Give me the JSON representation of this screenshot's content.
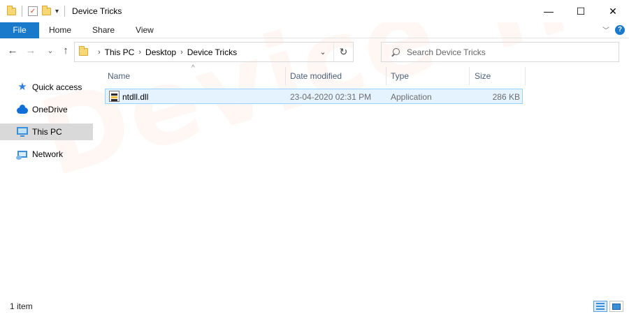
{
  "window": {
    "title": "Device Tricks",
    "controls": {
      "minimize": "—",
      "maximize": "☐",
      "close": "✕"
    }
  },
  "quick_access_toolbar": {
    "customize_arrow": "▾"
  },
  "ribbon": {
    "tabs": [
      "File",
      "Home",
      "Share",
      "View"
    ],
    "collapse_icon": "chevron-down-icon",
    "help_label": "?"
  },
  "navigation": {
    "back_glyph": "←",
    "forward_glyph": "→",
    "recent_glyph": "⌄",
    "up_glyph": "↑"
  },
  "address_bar": {
    "breadcrumbs": [
      "This PC",
      "Desktop",
      "Device Tricks"
    ],
    "separator": "›",
    "dropdown_glyph": "⌄",
    "refresh_glyph": "↻"
  },
  "search": {
    "placeholder": "Search Device Tricks"
  },
  "sidebar": {
    "items": [
      {
        "label": "Quick access",
        "icon": "quick-access-star-icon",
        "selected": false
      },
      {
        "label": "OneDrive",
        "icon": "onedrive-cloud-icon",
        "selected": false
      },
      {
        "label": "This PC",
        "icon": "this-pc-monitor-icon",
        "selected": true
      },
      {
        "label": "Network",
        "icon": "network-icon",
        "selected": false
      }
    ]
  },
  "file_list": {
    "sort_indicator": "^",
    "columns": [
      "Name",
      "Date modified",
      "Type",
      "Size"
    ],
    "rows": [
      {
        "name": "ntdll.dll",
        "date_modified": "23-04-2020 02:31 PM",
        "type": "Application",
        "size": "286 KB",
        "icon": "dll-file-icon",
        "selected": true
      }
    ]
  },
  "watermark": {
    "text": "Device Tricks"
  },
  "status_bar": {
    "item_count": "1 item",
    "views": [
      "details-view-icon",
      "large-icons-view-icon"
    ]
  },
  "colors": {
    "file_tab_bg": "#1979ca",
    "selection_bg": "#e5f3ff",
    "selection_border": "#99d1ff",
    "sidebar_selected_bg": "#d9d9d9",
    "folder_yellow": "#f8d775",
    "watermark": "#ee8c64"
  }
}
